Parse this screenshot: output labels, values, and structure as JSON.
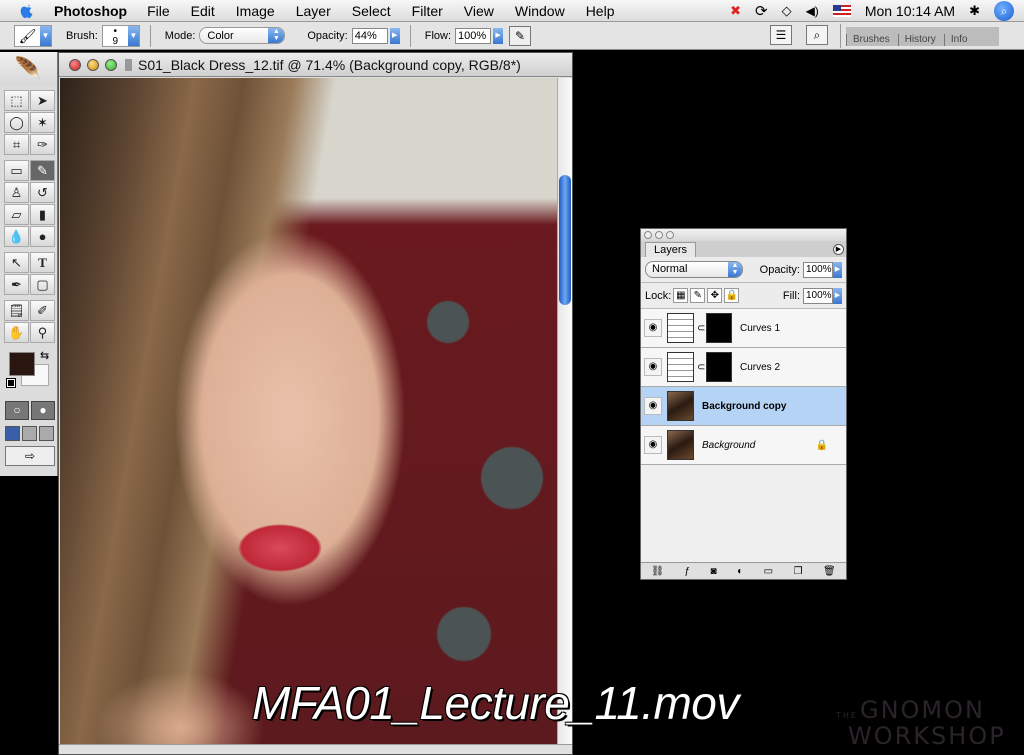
{
  "menubar": {
    "app": "Photoshop",
    "items": [
      "File",
      "Edit",
      "Image",
      "Layer",
      "Select",
      "Filter",
      "View",
      "Window",
      "Help"
    ],
    "clock": "Mon 10:14 AM",
    "status_icons": [
      "app-alert-icon",
      "sync-icon",
      "wifi-icon",
      "volume-icon",
      "us-flag-icon",
      "bluetooth-icon",
      "spotlight-icon"
    ]
  },
  "options": {
    "brush_label": "Brush:",
    "brush_size": "9",
    "mode_label": "Mode:",
    "mode_value": "Color",
    "opacity_label": "Opacity:",
    "opacity_value": "44%",
    "flow_label": "Flow:",
    "flow_value": "100%",
    "palette_tabs": [
      "Brushes",
      "History",
      "Info"
    ]
  },
  "document": {
    "title": "S01_Black Dress_12.tif @ 71.4% (Background copy, RGB/8*)",
    "zoom": "71.4%"
  },
  "toolbox": {
    "foreground_color": "#2a1610",
    "background_color": "#f8f8f8"
  },
  "layers_panel": {
    "tab": "Layers",
    "blend_mode": "Normal",
    "opacity_label": "Opacity:",
    "opacity_value": "100%",
    "lock_label": "Lock:",
    "fill_label": "Fill:",
    "fill_value": "100%",
    "layers": [
      {
        "name": "Curves 1",
        "type": "adjustment",
        "visible": true,
        "selected": false
      },
      {
        "name": "Curves 2",
        "type": "adjustment",
        "visible": true,
        "selected": false
      },
      {
        "name": "Background copy",
        "type": "pixel",
        "visible": true,
        "selected": true
      },
      {
        "name": "Background",
        "type": "pixel",
        "visible": true,
        "selected": false,
        "locked": true
      }
    ]
  },
  "overlay": {
    "caption": "MFA01_Lecture_11.mov",
    "watermark_small": "the",
    "watermark_line1": "Gnomon",
    "watermark_line2": "Workshop"
  }
}
